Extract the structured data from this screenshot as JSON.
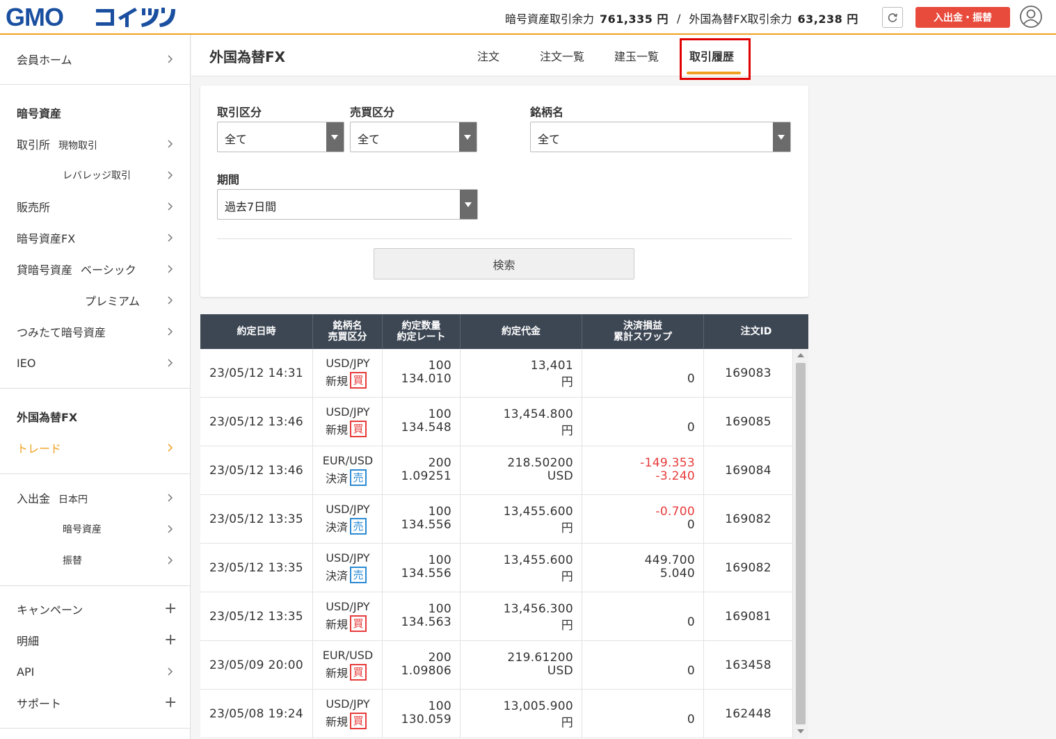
{
  "header": {
    "logo_text": "GMOコイン",
    "crypto_balance_label": "暗号資産取引余力",
    "crypto_balance_value": "761,335 円",
    "separator": "/",
    "fx_balance_label": "外国為替FX取引余力",
    "fx_balance_value": "63,238 円",
    "deposit_button": "入出金・振替",
    "refresh_icon": "refresh-icon",
    "user_icon": "user-icon",
    "accent_color": "#f0a020",
    "deposit_color": "#e84a3c"
  },
  "sidebar": {
    "home": "会員ホーム",
    "crypto_heading": "暗号資産",
    "exchange": "取引所",
    "exchange_spot": "現物取引",
    "exchange_leverage": "レバレッジ取引",
    "sales": "販売所",
    "crypto_fx": "暗号資産FX",
    "lending": "貸暗号資産",
    "lending_basic": "ベーシック",
    "lending_premium": "プレミアム",
    "tsumitate": "つみたて暗号資産",
    "ieo": "IEO",
    "fx_heading": "外国為替FX",
    "trade": "トレード",
    "deposit": "入出金",
    "deposit_jpy": "日本円",
    "deposit_crypto": "暗号資産",
    "transfer": "振替",
    "campaign": "キャンペーン",
    "statement": "明細",
    "api": "API",
    "support": "サポート",
    "plus_symbol": "+"
  },
  "tabs": {
    "page_title": "外国為替FX",
    "order": "注文",
    "order_list": "注文一覧",
    "position_list": "建玉一覧",
    "history": "取引履歴"
  },
  "filters": {
    "trade_type_label": "取引区分",
    "trade_type_value": "全て",
    "side_label": "売買区分",
    "side_value": "全て",
    "symbol_label": "銘柄名",
    "symbol_value": "全て",
    "period_label": "期間",
    "period_value": "過去7日間",
    "search_button": "検索"
  },
  "table": {
    "headers": {
      "date": "約定日時",
      "symbol1": "銘柄名",
      "symbol2": "売買区分",
      "qty1": "約定数量",
      "qty2": "約定レート",
      "amount": "約定代金",
      "pl1": "決済損益",
      "pl2": "累計スワップ",
      "order_id": "注文ID"
    },
    "rows": [
      {
        "date": "23/05/12 14:31",
        "pair": "USD/JPY",
        "kind": "新規",
        "side": "買",
        "side_type": "buy",
        "qty": "100",
        "rate": "134.010",
        "amount": "13,401",
        "currency": "円",
        "pl": "",
        "swap": "0",
        "id": "169083"
      },
      {
        "date": "23/05/12 13:46",
        "pair": "USD/JPY",
        "kind": "新規",
        "side": "買",
        "side_type": "buy",
        "qty": "100",
        "rate": "134.548",
        "amount": "13,454.800",
        "currency": "円",
        "pl": "",
        "swap": "0",
        "id": "169085"
      },
      {
        "date": "23/05/12 13:46",
        "pair": "EUR/USD",
        "kind": "決済",
        "side": "売",
        "side_type": "sell",
        "qty": "200",
        "rate": "1.09251",
        "amount": "218.50200",
        "currency": "USD",
        "pl": "-149.353",
        "swap": "-3.240",
        "id": "169084"
      },
      {
        "date": "23/05/12 13:35",
        "pair": "USD/JPY",
        "kind": "決済",
        "side": "売",
        "side_type": "sell",
        "qty": "100",
        "rate": "134.556",
        "amount": "13,455.600",
        "currency": "円",
        "pl": "-0.700",
        "swap": "0",
        "id": "169082"
      },
      {
        "date": "23/05/12 13:35",
        "pair": "USD/JPY",
        "kind": "決済",
        "side": "売",
        "side_type": "sell",
        "qty": "100",
        "rate": "134.556",
        "amount": "13,455.600",
        "currency": "円",
        "pl": "449.700",
        "swap": "5.040",
        "id": "169082"
      },
      {
        "date": "23/05/12 13:35",
        "pair": "USD/JPY",
        "kind": "新規",
        "side": "買",
        "side_type": "buy",
        "qty": "100",
        "rate": "134.563",
        "amount": "13,456.300",
        "currency": "円",
        "pl": "",
        "swap": "0",
        "id": "169081"
      },
      {
        "date": "23/05/09 20:00",
        "pair": "EUR/USD",
        "kind": "新規",
        "side": "買",
        "side_type": "buy",
        "qty": "200",
        "rate": "1.09806",
        "amount": "219.61200",
        "currency": "USD",
        "pl": "",
        "swap": "0",
        "id": "163458"
      },
      {
        "date": "23/05/08 19:24",
        "pair": "USD/JPY",
        "kind": "新規",
        "side": "買",
        "side_type": "buy",
        "qty": "100",
        "rate": "130.059",
        "amount": "13,005.900",
        "currency": "円",
        "pl": "",
        "swap": "0",
        "id": "162448"
      }
    ]
  }
}
